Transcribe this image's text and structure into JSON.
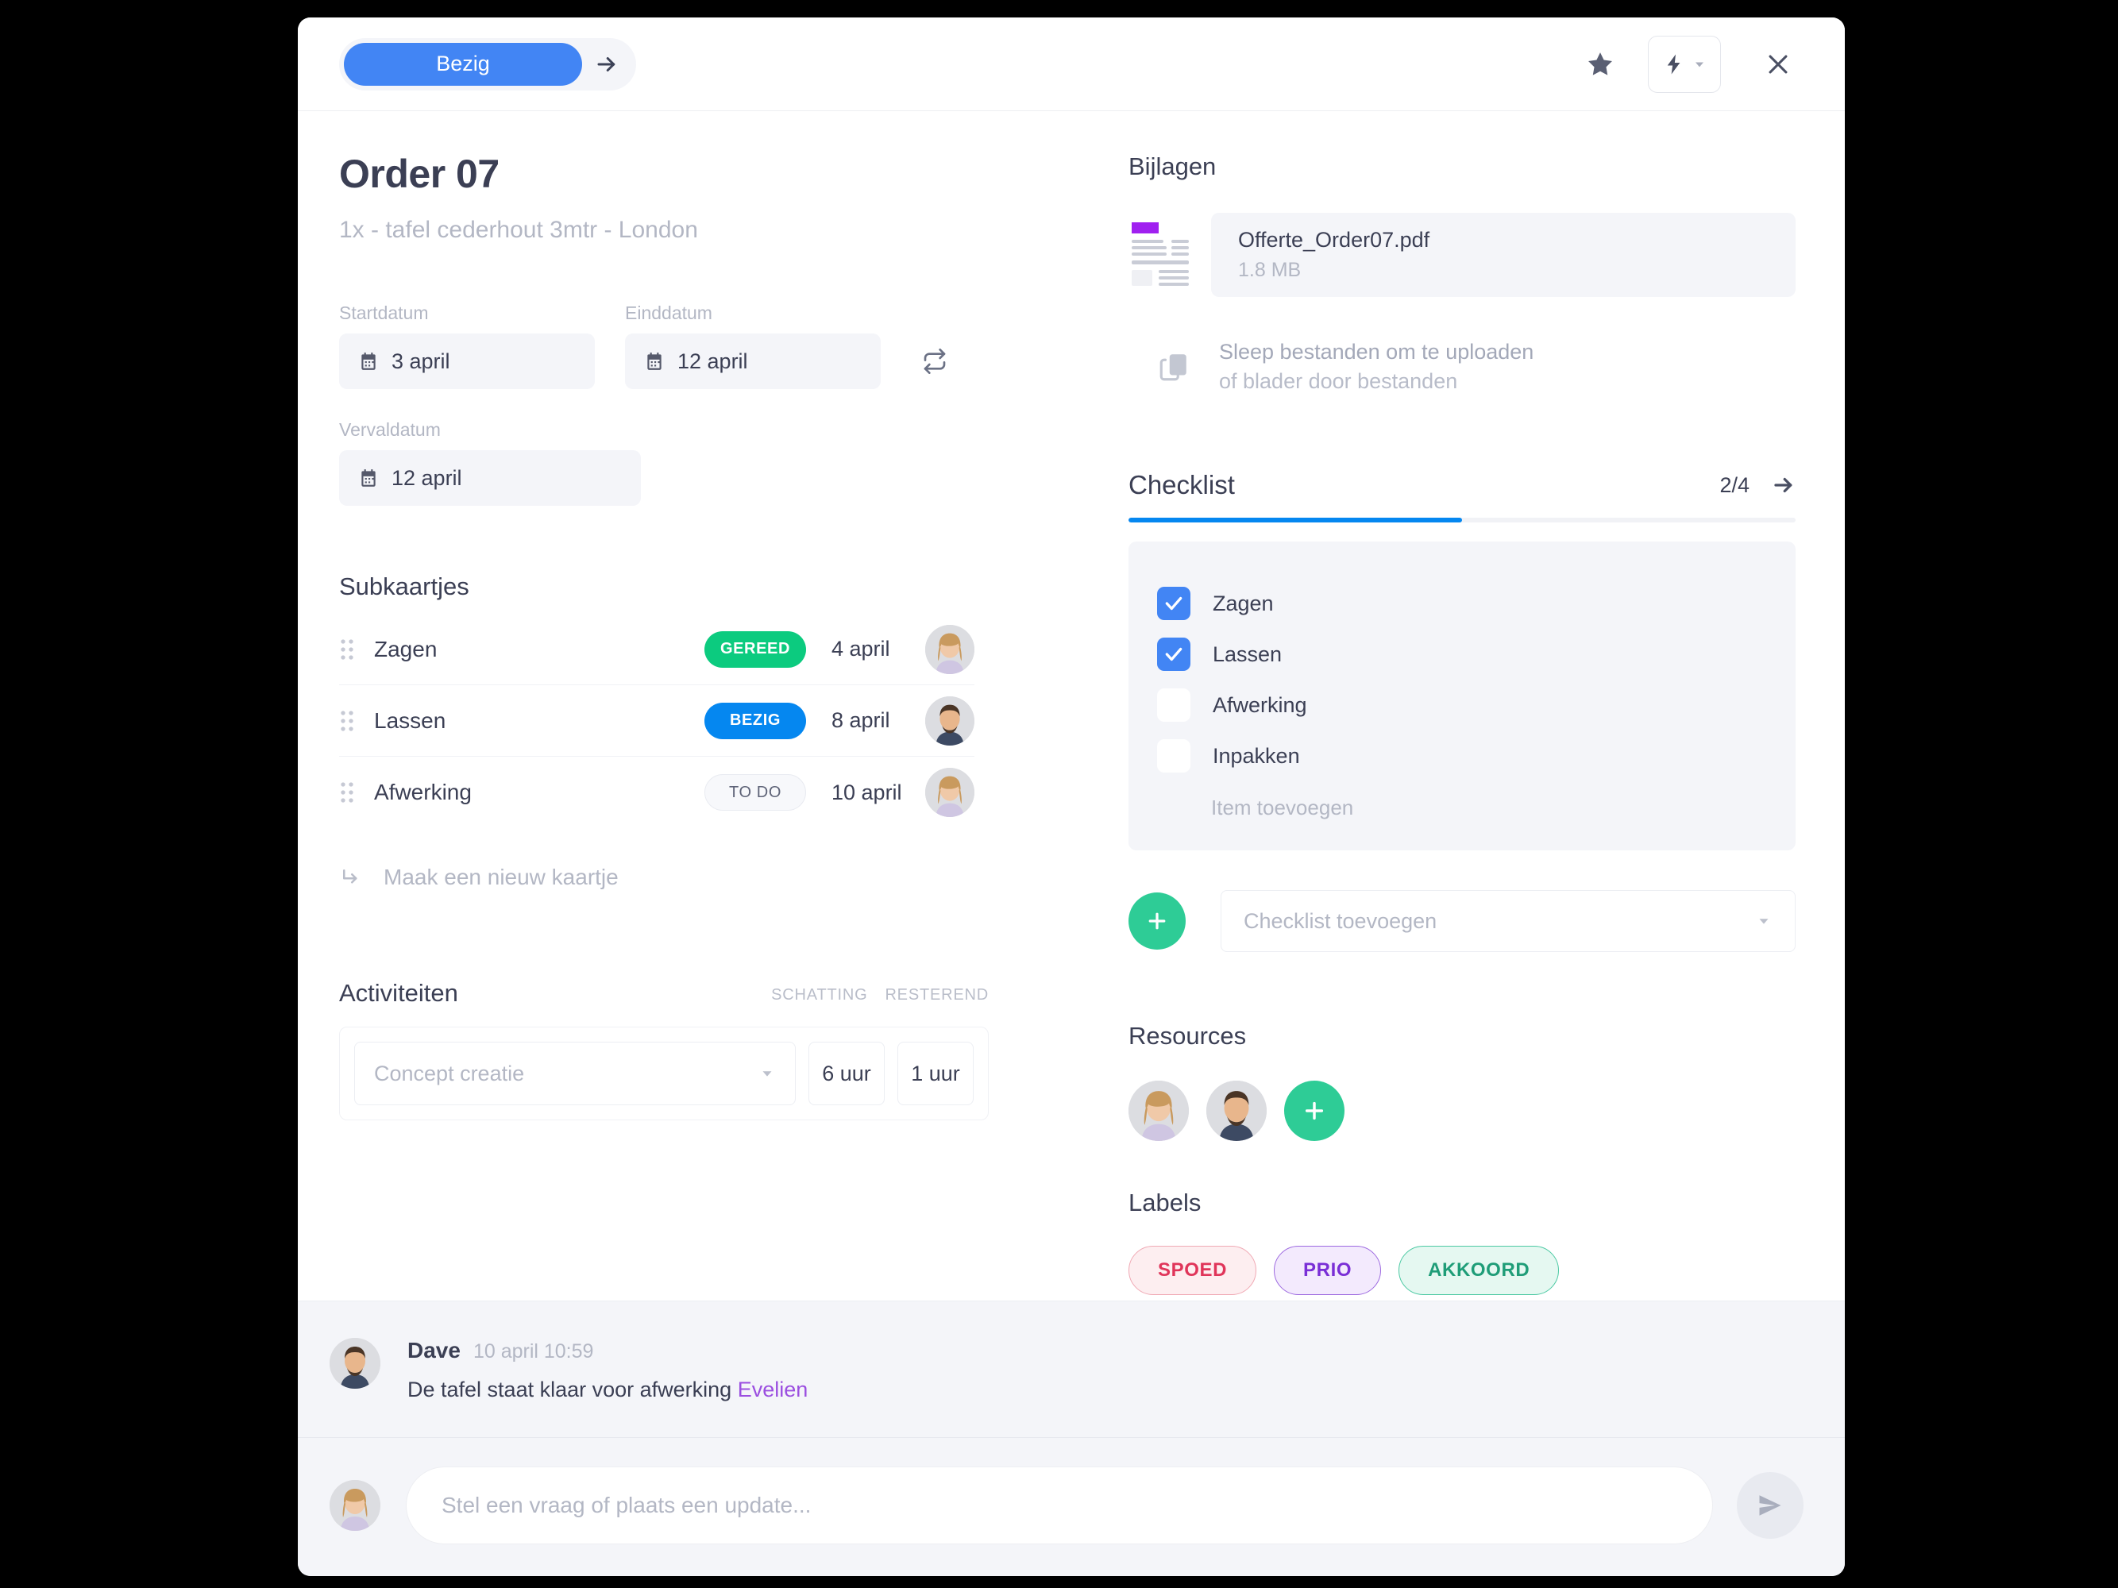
{
  "topbar": {
    "status_label": "Bezig",
    "next_icon": "arrow-right-icon",
    "star_icon": "star-icon",
    "flash_icon": "lightning-bolt-icon",
    "chevron_icon": "chevron-down-icon",
    "close_icon": "close-icon"
  },
  "card": {
    "title": "Order 07",
    "subtitle": "1x - tafel cederhout 3mtr - London"
  },
  "dates": {
    "start_label": "Startdatum",
    "start_value": "3 april",
    "end_label": "Einddatum",
    "end_value": "12 april",
    "due_label": "Vervaldatum",
    "due_value": "12 april",
    "swap_icon": "swap-arrows-icon",
    "calendar_icon": "calendar-icon"
  },
  "subcards": {
    "heading": "Subkaartjes",
    "rows": [
      {
        "name": "Zagen",
        "status": "GEREED",
        "date": "4 april"
      },
      {
        "name": "Lassen",
        "status": "BEZIG",
        "date": "8 april"
      },
      {
        "name": "Afwerking",
        "status": "TO DO",
        "date": "10 april"
      }
    ],
    "new_card_label": "Maak een nieuw kaartje",
    "new_card_icon": "arrow-return-icon",
    "drag_icon": "drag-handle-icon"
  },
  "activities": {
    "heading": "Activiteiten",
    "col_estimate": "SCHATTING",
    "col_remaining": "RESTEREND",
    "select_placeholder": "Concept creatie",
    "estimate_value": "6 uur",
    "remaining_value": "1 uur",
    "dropdown_icon": "chevron-down-icon"
  },
  "attachments": {
    "heading": "Bijlagen",
    "file_name": "Offerte_Order07.pdf",
    "file_size": "1.8 MB",
    "thumb_icon": "pdf-document-thumbnail",
    "drop_icon": "copy-files-icon",
    "drop_line1": "Sleep bestanden om te uploaden",
    "drop_line2": "of blader door bestanden"
  },
  "checklist": {
    "heading": "Checklist",
    "count": "2/4",
    "progress_percent": 50,
    "arrow_icon": "arrow-right-icon",
    "items": [
      {
        "label": "Zagen",
        "checked": true
      },
      {
        "label": "Lassen",
        "checked": true
      },
      {
        "label": "Afwerking",
        "checked": false
      },
      {
        "label": "Inpakken",
        "checked": false
      }
    ],
    "add_item_label": "Item toevoegen",
    "add_button_icon": "plus-icon",
    "add_select_placeholder": "Checklist toevoegen",
    "add_select_icon": "chevron-down-icon"
  },
  "resources": {
    "heading": "Resources",
    "add_icon": "plus-icon",
    "avatars": [
      "avatar-woman",
      "avatar-man"
    ]
  },
  "labels": {
    "heading": "Labels",
    "chips": [
      {
        "text": "SPOED",
        "color": "#e0355a"
      },
      {
        "text": "PRIO",
        "color": "#7a2fd6"
      },
      {
        "text": "AKKOORD",
        "color": "#1f9d78"
      }
    ]
  },
  "footer": {
    "comment": {
      "author": "Dave",
      "time": "10 april 10:59",
      "text_before": "De tafel staat klaar voor afwerking ",
      "mention": "Evelien",
      "avatar": "avatar-man"
    },
    "composer": {
      "placeholder": "Stel een vraag of plaats een update...",
      "send_icon": "send-icon",
      "avatar": "avatar-woman"
    }
  },
  "colors": {
    "accent_blue": "#4285f4",
    "status_bezig": "#0587f0",
    "status_gereed": "#0ccb7f",
    "green_action": "#2ecc96",
    "panel_bg": "#f4f5f9",
    "text_dark": "#3b3f54",
    "text_muted": "#b3b7c4"
  }
}
